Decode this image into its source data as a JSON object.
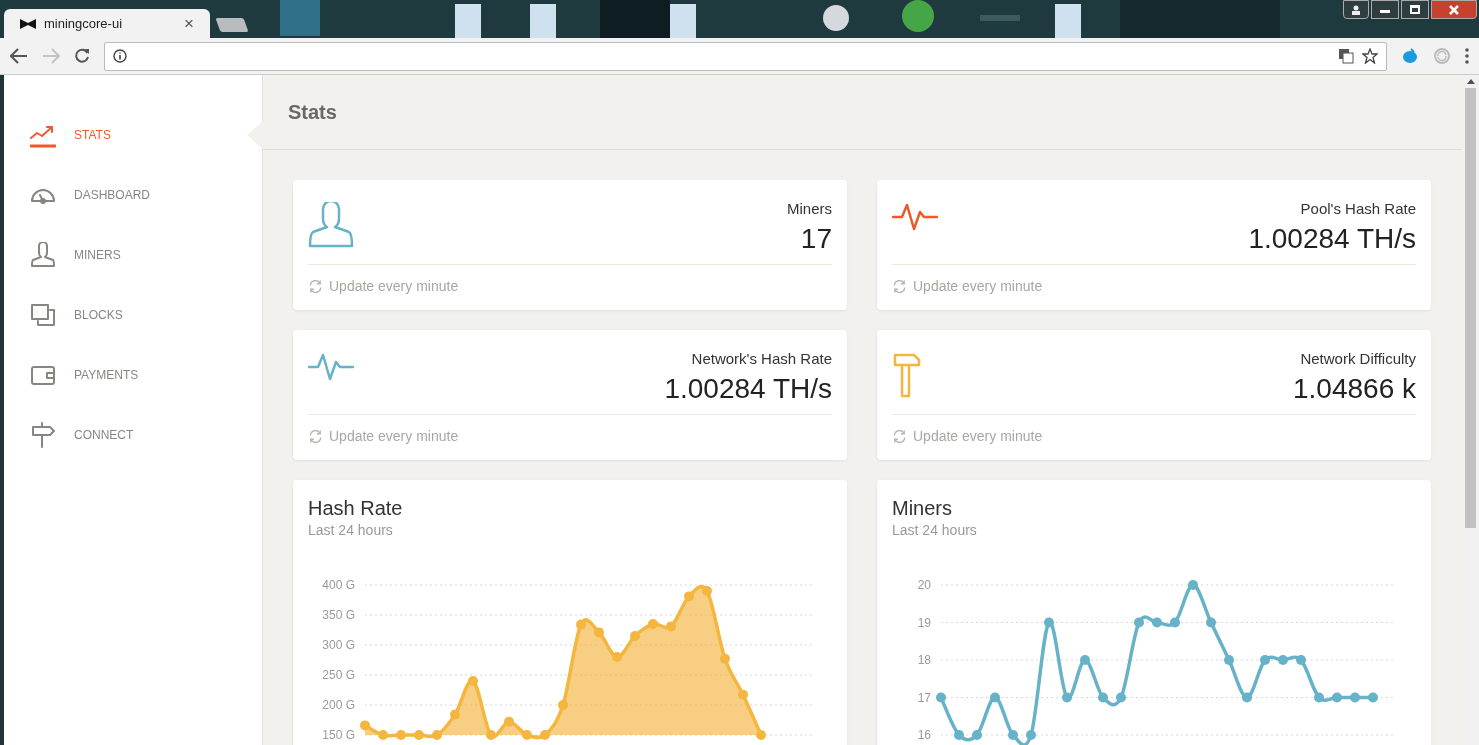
{
  "browser": {
    "tab": {
      "title": "miningcore-ui",
      "close": "×"
    }
  },
  "sidebar": {
    "items": [
      {
        "label": "STATS",
        "selected": true
      },
      {
        "label": "DASHBOARD",
        "selected": false
      },
      {
        "label": "MINERS",
        "selected": false
      },
      {
        "label": "BLOCKS",
        "selected": false
      },
      {
        "label": "PAYMENTS",
        "selected": false
      },
      {
        "label": "CONNECT",
        "selected": false
      }
    ]
  },
  "page": {
    "title": "Stats"
  },
  "stat_cards": [
    {
      "label": "Miners",
      "value": "17",
      "footer": "Update every minute"
    },
    {
      "label": "Pool's Hash Rate",
      "value": "1.00284 TH/s",
      "footer": "Update every minute"
    },
    {
      "label": "Network's Hash Rate",
      "value": "1.00284 TH/s",
      "footer": "Update every minute"
    },
    {
      "label": "Network Difficulty",
      "value": "1.04866 k",
      "footer": "Update every minute"
    }
  ],
  "chart_cards": [
    {
      "title": "Hash Rate",
      "subtitle": "Last 24 hours",
      "chart_data": {
        "type": "area",
        "grid": true,
        "ylim": [
          150,
          400
        ],
        "yticks": [
          {
            "value": 150,
            "label": "150 G"
          },
          {
            "value": 200,
            "label": "200 G"
          },
          {
            "value": 250,
            "label": "250 G"
          },
          {
            "value": 300,
            "label": "300 G"
          },
          {
            "value": 350,
            "label": "350 G"
          },
          {
            "value": 400,
            "label": "400 G"
          }
        ],
        "series": [
          {
            "color": "#f4b63f",
            "marker": true,
            "values": [
              166,
              150,
              150,
              150,
              150,
              184,
              240,
              150,
              172,
              150,
              150,
              200,
              334,
              321,
              280,
              315,
              335,
              331,
              381,
              390,
              277,
              217,
              150
            ]
          }
        ]
      }
    },
    {
      "title": "Miners",
      "subtitle": "Last 24 hours",
      "chart_data": {
        "type": "line",
        "grid": true,
        "ylim": [
          16,
          20
        ],
        "yticks": [
          16,
          17,
          18,
          19,
          20
        ],
        "series": [
          {
            "color": "#66b2c8",
            "marker": true,
            "values": [
              17,
              16,
              16,
              17,
              16,
              16,
              19,
              17,
              18,
              17,
              17,
              19,
              19,
              19,
              20,
              19,
              18,
              17,
              18,
              18,
              18,
              17,
              17,
              17,
              17
            ]
          }
        ]
      }
    }
  ]
}
